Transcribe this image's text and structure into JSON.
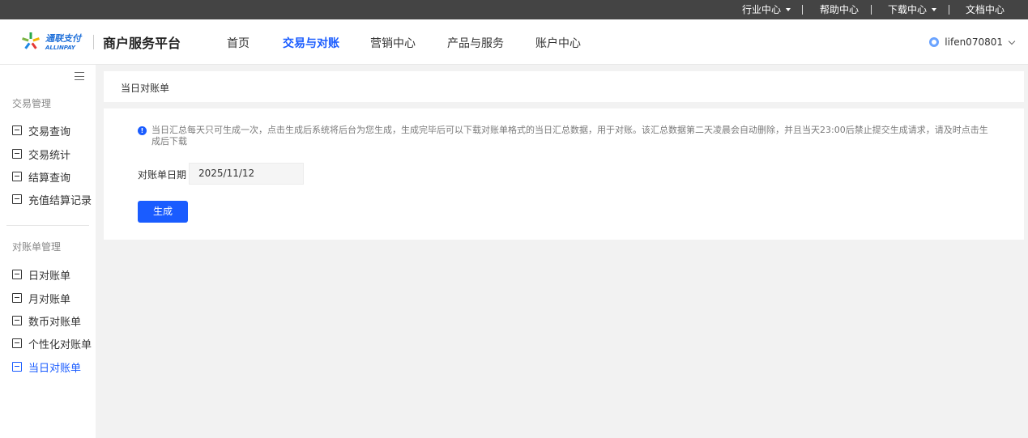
{
  "util_bar": {
    "items": [
      {
        "label": "行业中心",
        "has_dropdown": true
      },
      {
        "label": "帮助中心",
        "has_dropdown": false
      },
      {
        "label": "下载中心",
        "has_dropdown": true
      },
      {
        "label": "文档中心",
        "has_dropdown": false
      }
    ]
  },
  "header": {
    "logo_text": "通联支付",
    "logo_subtext": "ALLINPAY",
    "platform_title": "商户服务平台",
    "nav": [
      {
        "label": "首页",
        "active": false
      },
      {
        "label": "交易与对账",
        "active": true
      },
      {
        "label": "营销中心",
        "active": false
      },
      {
        "label": "产品与服务",
        "active": false
      },
      {
        "label": "账户中心",
        "active": false
      }
    ],
    "username": "lifen070801"
  },
  "sidebar": {
    "groups": [
      {
        "title": "交易管理",
        "items": [
          {
            "label": "交易查询",
            "icon": "calendar-icon",
            "active": false
          },
          {
            "label": "交易统计",
            "icon": "chart-icon",
            "active": false
          },
          {
            "label": "结算查询",
            "icon": "ledger-icon",
            "active": false
          },
          {
            "label": "充值结算记录",
            "icon": "clipboard-icon",
            "active": false
          }
        ]
      },
      {
        "title": "对账单管理",
        "items": [
          {
            "label": "日对账单",
            "icon": "daily-bill-icon",
            "active": false
          },
          {
            "label": "月对账单",
            "icon": "monthly-bill-icon",
            "active": false
          },
          {
            "label": "数币对账单",
            "icon": "digital-currency-icon",
            "active": false
          },
          {
            "label": "个性化对账单",
            "icon": "custom-bill-icon",
            "active": false
          },
          {
            "label": "当日对账单",
            "icon": "today-bill-icon",
            "active": true
          }
        ]
      }
    ]
  },
  "breadcrumb": {
    "title": "当日对账单"
  },
  "main": {
    "notice": "当日汇总每天只可生成一次，点击生成后系统将后台为您生成，生成完毕后可以下载对账单格式的当日汇总数据，用于对账。该汇总数据第二天凌晨会自动删除，并且当天23:00后禁止提交生成请求，请及时点击生成后下载",
    "date_label": "对账单日期",
    "date_value": "2025/11/12",
    "generate_button": "生成"
  },
  "colors": {
    "accent": "#1a5cff",
    "util_bar_bg": "#444444",
    "page_bg": "#f2f2f2"
  }
}
